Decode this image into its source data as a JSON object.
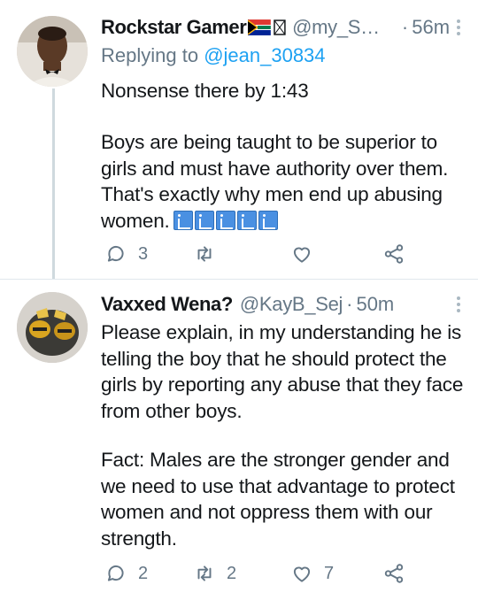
{
  "colors": {
    "text": "#14171a",
    "secondary": "#657786",
    "link": "#1da1f2",
    "thread_line": "#cfd9de"
  },
  "tweets": [
    {
      "display_name": "Rockstar Gamer",
      "handle": "@my_Sm...",
      "separator": "·",
      "time": "56m",
      "replying_prefix": "Replying to ",
      "replying_to": "@jean_30834",
      "text_line_1": "Nonsense there by 1:43",
      "text_paragraph_2": "Boys are being taught to be superior to girls and must have authority over them. That's exactly why men end up abusing women.",
      "emoji_icons": [
        "woman-lifting-icon",
        "woman-lifting-icon",
        "woman-lifting-icon",
        "woman-lifting-icon",
        "woman-lifting-icon"
      ],
      "reply_count": "3",
      "retweet_count": "",
      "like_count": ""
    },
    {
      "display_name": "Vaxxed Wena?",
      "handle": "@KayB_Sej",
      "separator": "·",
      "time": "50m",
      "text_paragraph_1": "Please explain, in my understanding he is telling the boy that he should protect the girls by reporting any abuse that they face from other boys.",
      "text_paragraph_2": "Fact: Males are the stronger gender and we need to use that advantage to protect women and not oppress them with our strength.",
      "reply_count": "2",
      "retweet_count": "2",
      "like_count": "7"
    }
  ]
}
